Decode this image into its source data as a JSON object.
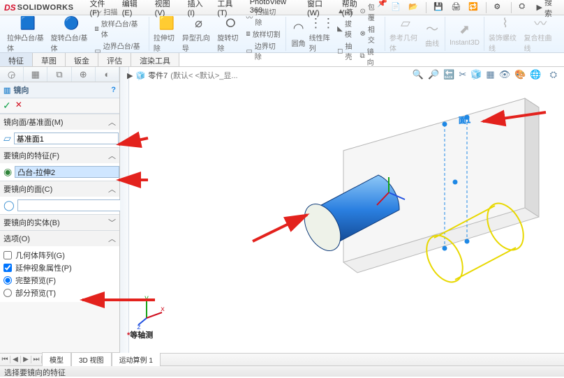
{
  "brand": {
    "ds": "DS",
    "sw": "SOLIDWORKS"
  },
  "menu": [
    "文件(F)",
    "编辑(E)",
    "视图(V)",
    "插入(I)",
    "工具(T)",
    "PhotoView 360",
    "窗口(W)",
    "帮助(H)"
  ],
  "search_label": "搜索",
  "ribbon": {
    "g1": [
      "拉伸凸台/基体",
      "旋转凸台/基体"
    ],
    "g1_sub": [
      "扫描",
      "放样凸台/基体",
      "边界凸台/基体"
    ],
    "g2": [
      "拉伸切除",
      "异型孔向导",
      "旋转切除"
    ],
    "g2_sub": [
      "扫描切除",
      "放样切割",
      "边界切除"
    ],
    "g3": [
      "圆角",
      "线性阵列"
    ],
    "g3_sub": [
      "筋",
      "拔模",
      "抽壳"
    ],
    "g3_sub2": [
      "包覆",
      "相交",
      "镜向"
    ],
    "g4": [
      "参考几何体",
      "曲线"
    ],
    "g5": "Instant3D",
    "g6": [
      "装饰螺纹线",
      "复合柱曲线"
    ]
  },
  "tabs": [
    "特征",
    "草图",
    "钣金",
    "评估",
    "渲染工具"
  ],
  "left_tabs_icons": [
    "◶",
    "▦",
    "⧉",
    "⊕",
    "◐"
  ],
  "feature": {
    "icon": "▥",
    "title": "镜向",
    "help": "?",
    "ok": "✓",
    "cancel": "✕"
  },
  "sections": {
    "mirror_plane": {
      "label": "镜向面/基准面(M)",
      "value": "基准面1"
    },
    "features": {
      "label": "要镜向的特征(F)",
      "value": "凸台-拉伸2"
    },
    "faces": {
      "label": "要镜向的面(C)",
      "value": ""
    },
    "bodies": {
      "label": "要镜向的实体(B)"
    },
    "options": {
      "label": "选项(O)",
      "chk_geom": "几何体阵列(G)",
      "chk_vis": "延伸视象属性(P)",
      "radio_full": "完整预览(F)",
      "radio_part": "部分预览(T)"
    }
  },
  "breadcrumb": {
    "doc": "零件7",
    "state": "(默认< <默认>_显..."
  },
  "triad": {
    "x": "x",
    "y": "y",
    "z": "z"
  },
  "iso": "等轴测",
  "bottom_tabs": [
    "模型",
    "3D 视图",
    "运动算例 1"
  ],
  "statusbar": "选择要镜向的特征",
  "colors": {
    "blue": "#267dcc",
    "sel_bg": "#cfe6ff",
    "red_arrow": "#e3221d",
    "slab": "#efefef",
    "slab_edge": "#bfbfbf",
    "cyl_blue1": "#6fb5f3",
    "cyl_blue2": "#1b66c4",
    "cyl_face": "#f4f7f0",
    "yellow": "#e8d800"
  }
}
